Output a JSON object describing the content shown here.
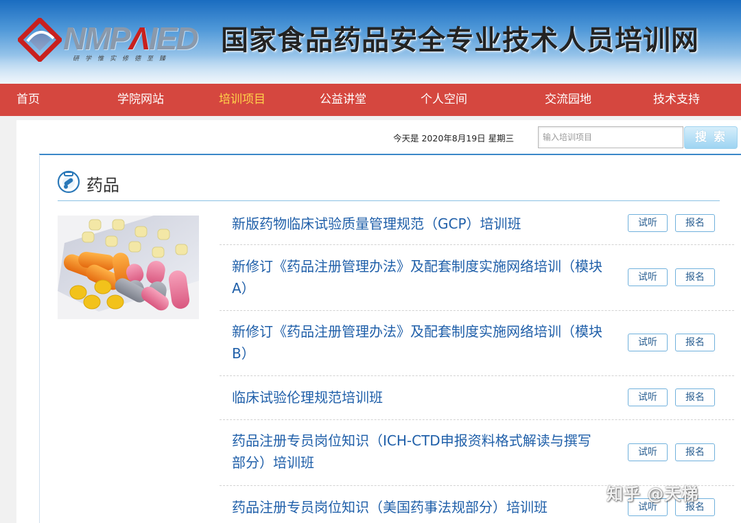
{
  "header": {
    "logo_text_left": "NMP",
    "logo_text_mid": "Λ",
    "logo_text_right": "IED",
    "logo_slogan": "研学惟实修德至臻",
    "site_title": "国家食品药品安全专业技术人员培训网"
  },
  "nav": {
    "items": [
      {
        "label": "首页"
      },
      {
        "label": "学院网站"
      },
      {
        "label": "培训项目"
      },
      {
        "label": "公益讲堂"
      },
      {
        "label": "个人空间"
      },
      {
        "label": "交流园地"
      },
      {
        "label": "技术支持"
      }
    ],
    "active_index": 2
  },
  "toolbar": {
    "date_text": "今天是 2020年8月19日 星期三",
    "search_placeholder": "输入培训项目",
    "search_button": "搜 索"
  },
  "section": {
    "title": "药品"
  },
  "courses": [
    {
      "title": "新版药物临床试验质量管理规范（GCP）培训班",
      "trial_label": "试听",
      "signup_label": "报名"
    },
    {
      "title": "新修订《药品注册管理办法》及配套制度实施网络培训（模块A）",
      "trial_label": "试听",
      "signup_label": "报名"
    },
    {
      "title": "新修订《药品注册管理办法》及配套制度实施网络培训（模块B）",
      "trial_label": "试听",
      "signup_label": "报名"
    },
    {
      "title": "临床试验伦理规范培训班",
      "trial_label": "试听",
      "signup_label": "报名"
    },
    {
      "title": "药品注册专员岗位知识（ICH-CTD申报资料格式解读与撰写部分）培训班",
      "trial_label": "试听",
      "signup_label": "报名"
    },
    {
      "title": "药品注册专员岗位知识（美国药事法规部分）培训班",
      "trial_label": "试听",
      "signup_label": "报名"
    }
  ],
  "watermark": "知乎 @天梯",
  "colors": {
    "nav_bg": "#d5473f",
    "nav_active": "#ffd24a",
    "course_link": "#1f5fa9",
    "accent_rule": "#3a87c8"
  }
}
